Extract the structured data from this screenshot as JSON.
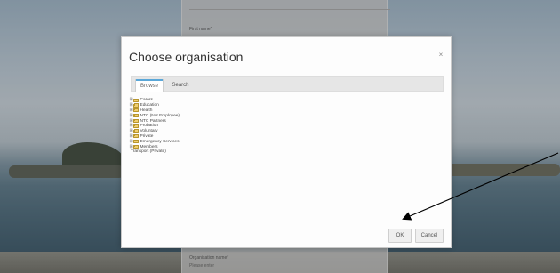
{
  "form": {
    "first_name_label": "First name",
    "org_name_label": "Organisation name",
    "org_name_hint": "Please enter",
    "required_mark": "*"
  },
  "modal": {
    "title": "Choose organisation",
    "close_glyph": "×",
    "tabs": [
      {
        "label": "Browse",
        "active": true
      },
      {
        "label": "Search",
        "active": false
      }
    ],
    "tree": [
      {
        "label": "Carers",
        "expandable": true
      },
      {
        "label": "Education",
        "expandable": true
      },
      {
        "label": "Health",
        "expandable": true
      },
      {
        "label": "NTC (Not Employee)",
        "expandable": true
      },
      {
        "label": "NTC Partners",
        "expandable": true
      },
      {
        "label": "Probation",
        "expandable": true
      },
      {
        "label": "Voluntary",
        "expandable": true
      },
      {
        "label": "Private",
        "expandable": true
      },
      {
        "label": "Emergency Services",
        "expandable": true
      },
      {
        "label": "Members",
        "expandable": true
      },
      {
        "label": "Transport (Private)",
        "expandable": false
      }
    ],
    "expander_glyph": "⊞",
    "ok_label": "OK",
    "cancel_label": "Cancel"
  },
  "icons": {
    "close": "close-icon",
    "folder": "folder-icon",
    "expander": "plus-expander-icon"
  },
  "colors": {
    "tab_accent": "#5aa7d8",
    "folder": "#f0cf70",
    "arrow": "#000000"
  }
}
